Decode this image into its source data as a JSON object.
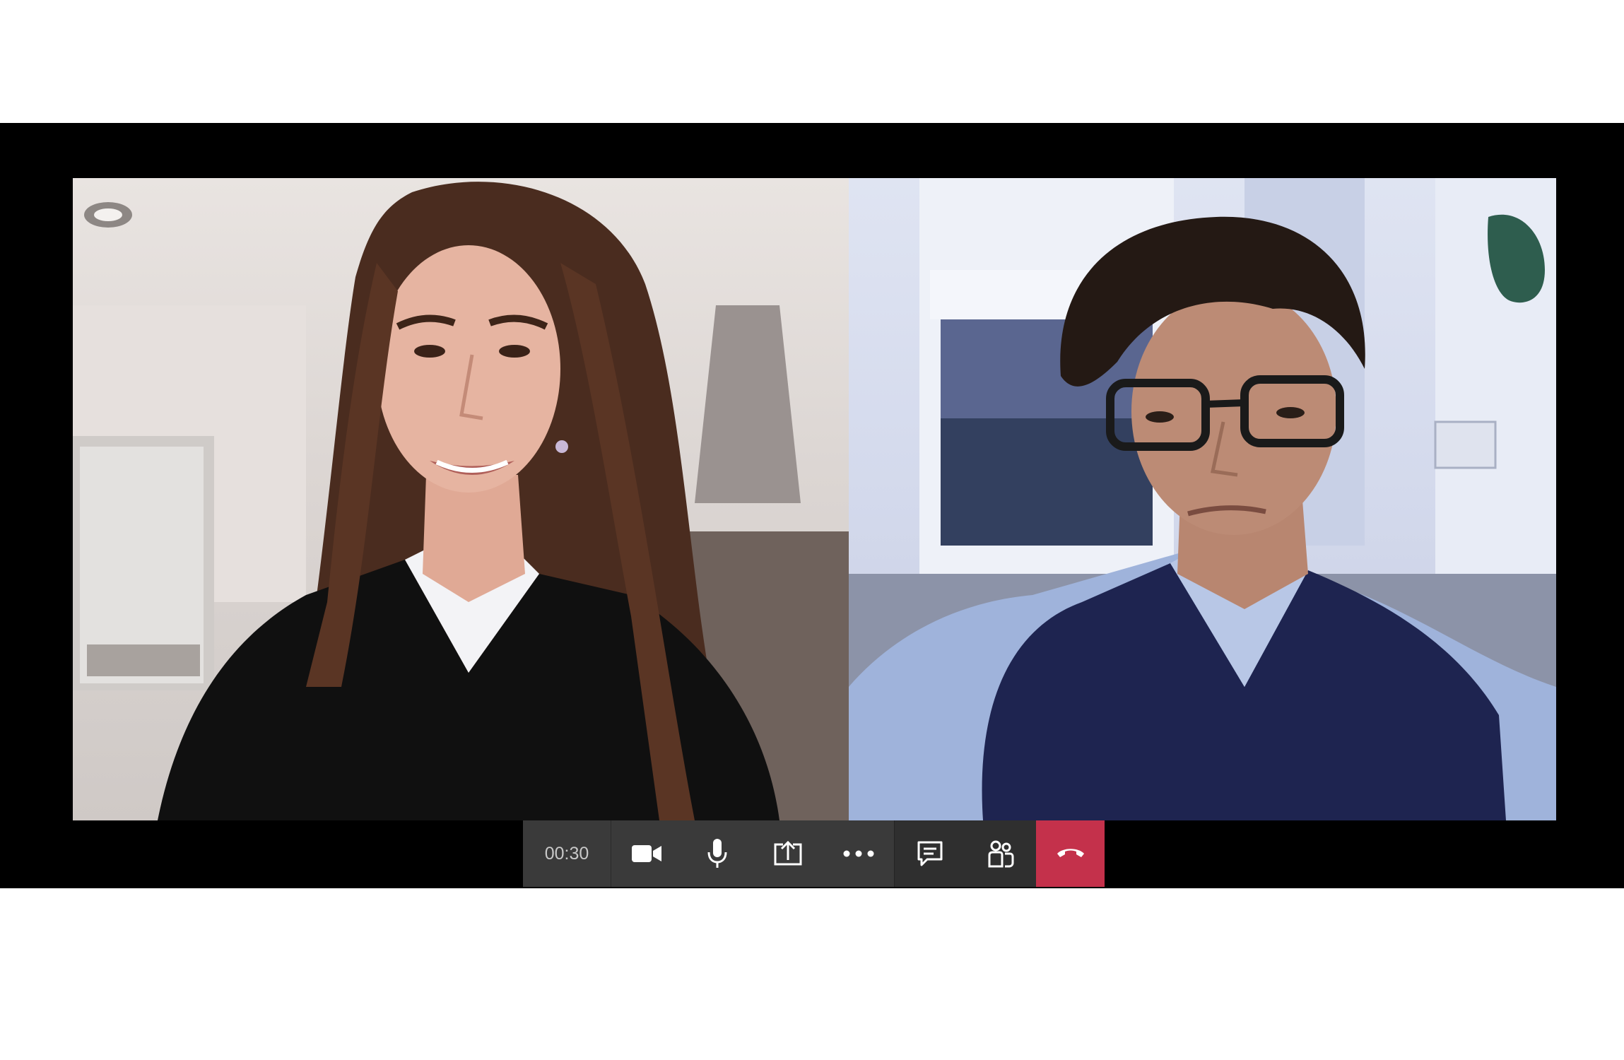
{
  "call": {
    "duration": "00:30"
  },
  "participants": [
    {
      "tile": "left"
    },
    {
      "tile": "right"
    }
  ],
  "toolbar": {
    "buttons": [
      {
        "icon": "video-camera-icon"
      },
      {
        "icon": "microphone-icon"
      },
      {
        "icon": "share-screen-icon"
      },
      {
        "icon": "more-options-icon"
      },
      {
        "icon": "chat-icon"
      },
      {
        "icon": "participants-icon"
      },
      {
        "icon": "hang-up-icon"
      }
    ]
  },
  "colors": {
    "window_background": "#000000",
    "toolbar_background": "#3a3a3a",
    "toolbar_icon": "#ffffff",
    "hang_up": "#c4314b"
  }
}
